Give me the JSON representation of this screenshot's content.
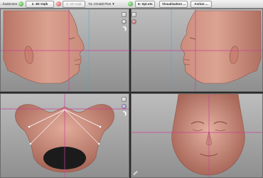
{
  "toolbar": {
    "item1": "...hadonnes",
    "item2": "2. 3D Oqik",
    "item3": "3. 4D Oqik",
    "item4": "7a: Armatit Pies",
    "item5": "6: Spl.ots",
    "item6": "Visualization ...",
    "item7": "Action ...",
    "colors": {
      "green": "#3aa336",
      "red": "#d24a4a"
    }
  },
  "viewports": {
    "top_left": {
      "view": "right-side-profile"
    },
    "top_right": {
      "view": "left-side-profile"
    },
    "bottom_left": {
      "view": "underside-view"
    },
    "bottom_right": {
      "view": "frontal-view"
    }
  },
  "colors": {
    "skin": "#d79a8a",
    "skin_shadow": "#9a5c52",
    "guide_line": "#cc3f9b",
    "background_top": "#bdbdbd",
    "background_bottom": "#8f8f8f"
  }
}
